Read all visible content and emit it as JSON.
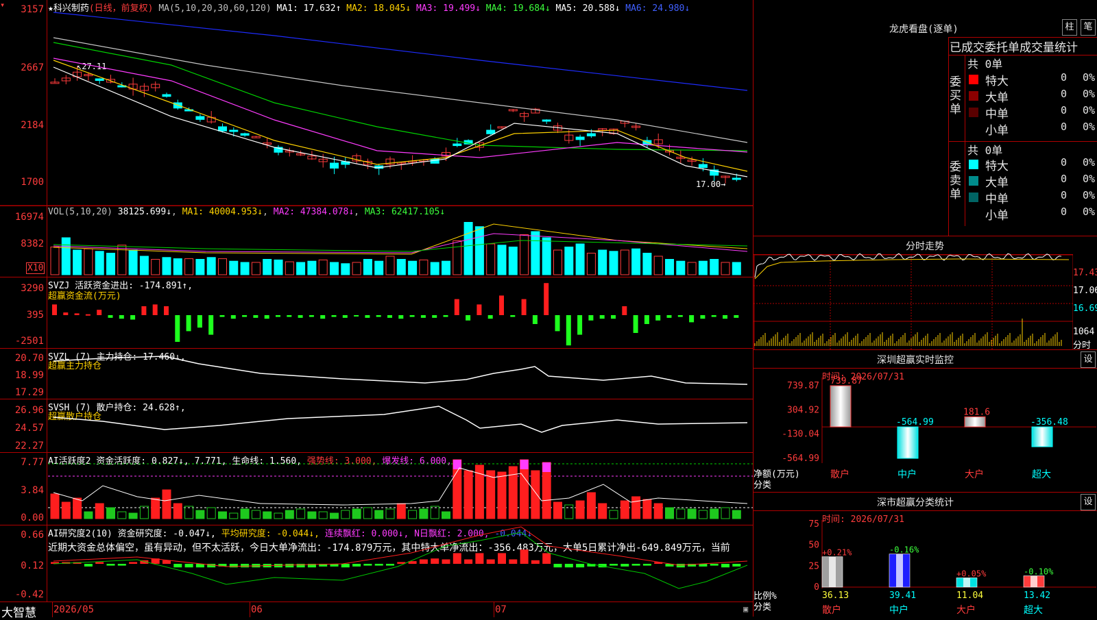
{
  "app": {
    "name": "大智慧"
  },
  "kline": {
    "stock_name": "科兴制药",
    "mode": "(日线，前复权)",
    "ma_prefix": "MA(5,10,20,30,60,120)",
    "ma1": "MA1: 17.632↑",
    "ma2": "MA2: 18.045↓",
    "ma3": "MA3: 19.499↓",
    "ma4": "MA4: 19.684↓",
    "ma5": "MA5: 20.588↓",
    "ma6": "MA6: 24.980↓",
    "y_ticks": [
      "3157",
      "2667",
      "2184",
      "1700"
    ],
    "high_label": "27.11",
    "low_label": "17.00"
  },
  "volume": {
    "title": "VOL(5,10,20)",
    "value": "38125.699↓",
    "ma1": "MA1: 40004.953↓",
    "ma2": "MA2: 47384.078↓",
    "ma3": "MA3: 62417.105↓",
    "y_ticks": [
      "16974",
      "8382"
    ],
    "unit": "X10"
  },
  "svzj": {
    "title": "SVZJ  活跃资金进出: -174.891↑,",
    "subtitle": "超赢资金流(万元)",
    "y_ticks": [
      "3290",
      "395",
      "-2501"
    ]
  },
  "svzl": {
    "title": "SVZL (7) 主力持仓: 17.460↓,",
    "subtitle": "超赢主力持仓",
    "y_ticks": [
      "20.70",
      "18.99",
      "17.29"
    ]
  },
  "svsh": {
    "title": "SVSH (7) 散户持仓: 24.628↑,",
    "subtitle": "超赢散户持仓",
    "y_ticks": [
      "26.96",
      "24.57",
      "22.27"
    ]
  },
  "ai_active": {
    "title": "AI活跃度2 资金活跃度: 0.827↓,",
    "v2": "7.771,",
    "life": "生命线: 1.560,",
    "strong": "强势线: 3.000,",
    "burst": "爆发线: 6.000,",
    "y_ticks": [
      "7.77",
      "3.84",
      "0.00"
    ]
  },
  "ai_research": {
    "title": "AI研究度2(10) 资金研究度: -0.047↓,",
    "avg": "平均研究度: -0.044↓,",
    "red_streak": "连续飘红: 0.000↓,",
    "n_red": "N日飘红: 2.000,",
    "last": "-0.044↓",
    "comment": "近期大资金总体偏空，虽有异动，但不太活跃，今日大单净流出：-174.879万元，其中特大单净流出：-356.483万元，大单5日累计净出-649.849万元，当前",
    "y_ticks": [
      "0.66",
      "0.12",
      "-0.42"
    ]
  },
  "date_axis": {
    "labels": [
      "2026/05",
      "06",
      "07"
    ]
  },
  "dragon": {
    "title": "龙虎看盘(逐单)",
    "tab1": "柱",
    "tab2": "笔",
    "subtitle": "已成交委托单成交量统计",
    "buy": {
      "label": "委买单",
      "total": "共 0单",
      "rows": [
        {
          "name": "特大",
          "count": "0",
          "pct": "0%",
          "color": "#ff0000"
        },
        {
          "name": "大单",
          "count": "0",
          "pct": "0%",
          "color": "#8c0000"
        },
        {
          "name": "中单",
          "count": "0",
          "pct": "0%",
          "color": "#5a0000"
        },
        {
          "name": "小单",
          "count": "0",
          "pct": "0%",
          "color": ""
        }
      ]
    },
    "sell": {
      "label": "委卖单",
      "total": "共 0单",
      "rows": [
        {
          "name": "特大",
          "count": "0",
          "pct": "0%",
          "color": "#00ffff"
        },
        {
          "name": "大单",
          "count": "0",
          "pct": "0%",
          "color": "#008c8c"
        },
        {
          "name": "中单",
          "count": "0",
          "pct": "0%",
          "color": "#006464"
        },
        {
          "name": "小单",
          "count": "0",
          "pct": "0%",
          "color": ""
        }
      ]
    }
  },
  "intraday": {
    "title": "分时走势",
    "y_ticks": [
      "17.43",
      "17.06",
      "16.69"
    ],
    "vol_tick": "1064",
    "vol_label": "分时"
  },
  "sz_monitor": {
    "title": "深圳超赢实时监控",
    "set": "设",
    "time": "时间: 2026/07/31",
    "y_ticks": [
      "739.87",
      "304.92",
      "-130.04",
      "-564.99"
    ],
    "ylabel1": "净额(万元)",
    "ylabel2": "分类",
    "categories": [
      "散户",
      "中户",
      "大户",
      "超大"
    ],
    "values": [
      739.87,
      -564.99,
      181.6,
      -356.48
    ],
    "value_labels": [
      "739.87",
      "-564.99",
      "181.6",
      "-356.48"
    ]
  },
  "sz_class": {
    "title": "深市超赢分类统计",
    "set": "设",
    "time": "时间: 2026/07/31",
    "y_ticks": [
      "75",
      "50",
      "25",
      "0"
    ],
    "ylabel1": "比例%",
    "ylabel2": "分类",
    "categories": [
      "散户",
      "中户",
      "大户",
      "超大"
    ],
    "values": [
      36.13,
      39.41,
      11.04,
      13.42
    ],
    "changes": [
      "+0.21%",
      "-0.16%",
      "+0.05%",
      "-0.10%"
    ],
    "value_labels": [
      "36.13",
      "39.41",
      "11.04",
      "13.42"
    ]
  },
  "colors": {
    "up": "#ff3c3c",
    "down": "#00ffff",
    "grid": "#b00000"
  }
}
